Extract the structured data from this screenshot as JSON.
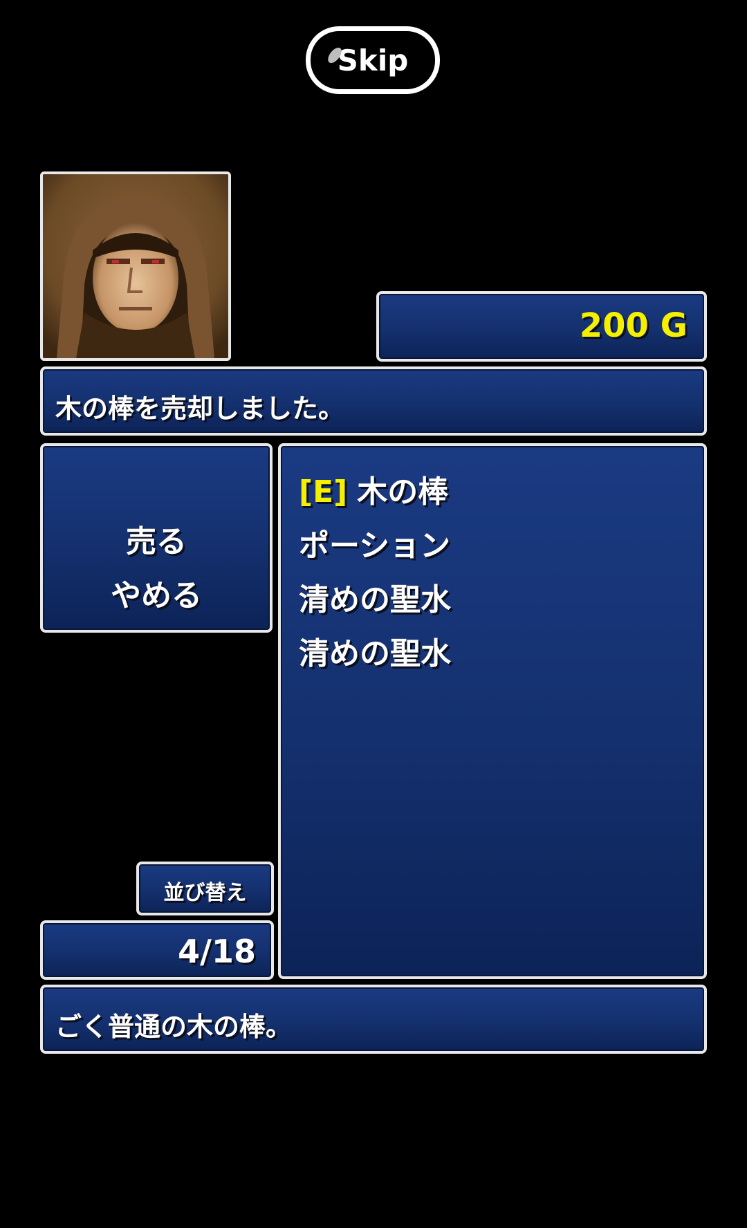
{
  "skip_button": {
    "label": "Skip"
  },
  "portrait": {
    "icon": "hooded-figure-portrait"
  },
  "gold": {
    "text": "200 G",
    "color": "#f5f000"
  },
  "message": {
    "text": "木の棒を売却しました。"
  },
  "commands": [
    {
      "label": "売る"
    },
    {
      "label": "やめる"
    }
  ],
  "items": [
    {
      "tag": "[E]",
      "name": "木の棒"
    },
    {
      "tag": "",
      "name": "ポーション"
    },
    {
      "tag": "",
      "name": "清めの聖水"
    },
    {
      "tag": "",
      "name": "清めの聖水"
    }
  ],
  "sort_button": {
    "label": "並び替え"
  },
  "inventory_count": {
    "text": "4/18"
  },
  "description": {
    "text": "ごく普通の木の棒。"
  },
  "colors": {
    "window_bg": "#14306e",
    "window_border": "#e8e8e8",
    "highlight": "#f5f000"
  }
}
